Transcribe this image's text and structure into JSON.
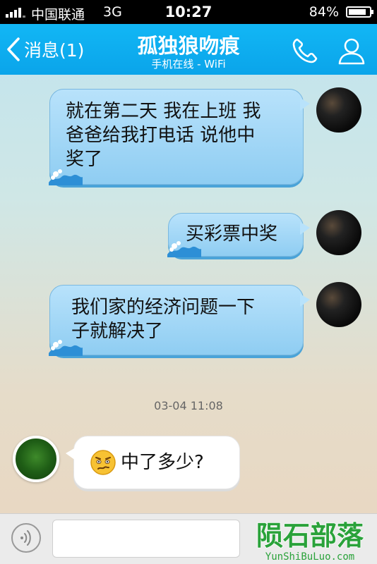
{
  "status_bar": {
    "carrier": "中国联通",
    "network": "3G",
    "time": "10:27",
    "battery_percent_label": "84%",
    "battery_level": 0.84
  },
  "header": {
    "back_label": "消息(1)",
    "title": "孤独狼吻痕",
    "subtitle": "手机在线 - WiFi",
    "call_icon": "phone-icon",
    "profile_icon": "person-icon"
  },
  "messages": [
    {
      "side": "sent",
      "text": "就在第二天 我在上班 我\n爸爸给我打电话 说他中\n奖了"
    },
    {
      "side": "sent",
      "text": "买彩票中奖"
    },
    {
      "side": "sent",
      "text": "我们家的经济问题一下\n子就解决了"
    },
    {
      "side": "received",
      "emoji": "worried-face-icon",
      "text": "中了多少?"
    }
  ],
  "timestamp": "03-04 11:08",
  "input_bar": {
    "voice_icon": "voice-icon",
    "input_value": ""
  },
  "watermark": {
    "logo_text": "陨石部落",
    "logo_url_text": "YunShiBuLuo.com"
  },
  "colors": {
    "nav_blue": "#0aa4ea",
    "sent_bubble": "#b8e2fb",
    "received_bubble": "#ffffff",
    "watermark_green": "#2aa23a"
  }
}
